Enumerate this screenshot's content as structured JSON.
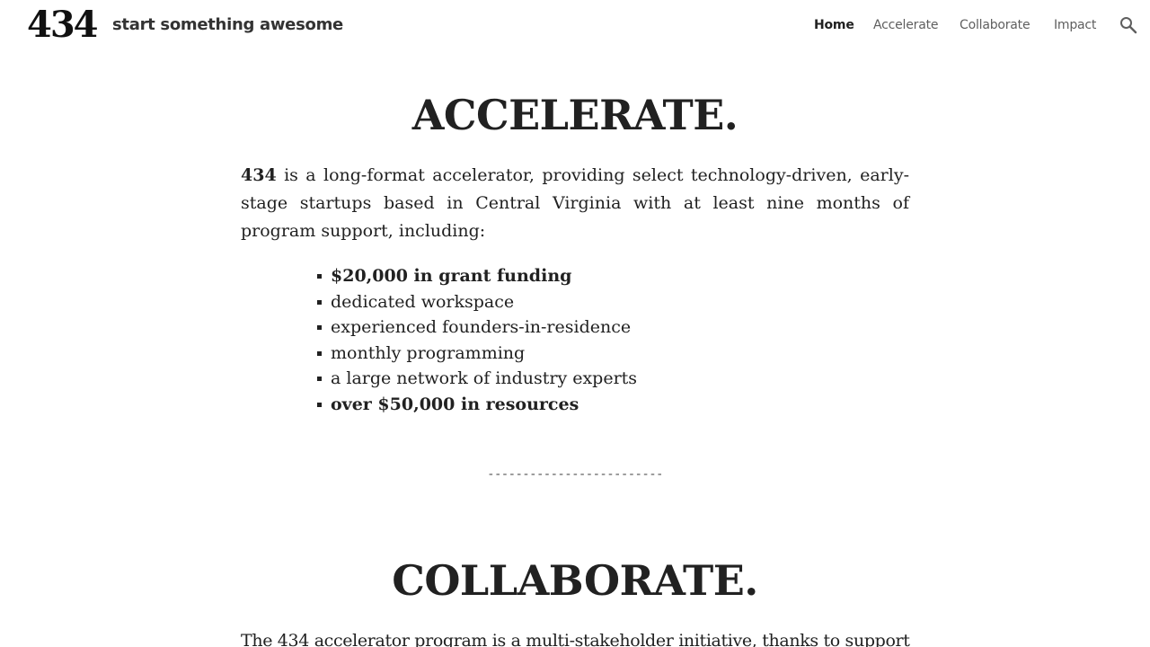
{
  "header": {
    "logo_text": "434",
    "site_title": "start something awesome",
    "nav": [
      {
        "label": "Home",
        "active": true
      },
      {
        "label": "Accelerate",
        "active": false
      },
      {
        "label": "Collaborate",
        "active": false
      },
      {
        "label": "Impact",
        "active": false
      }
    ],
    "search_icon": "search-icon"
  },
  "accelerate": {
    "heading": "ACCELERATE.",
    "intro_bold": "434",
    "intro_rest": " is a long-format accelerator, providing select technology-driven, early-stage startups based in Central Virginia with at least nine months of program support, including:",
    "items": [
      {
        "text": "$20,000 in grant funding",
        "bold": true
      },
      {
        "text": "dedicated workspace",
        "bold": false
      },
      {
        "text": "experienced founders-in-residence",
        "bold": false
      },
      {
        "text": "monthly programming",
        "bold": false
      },
      {
        "text": "a large network of industry experts",
        "bold": false
      },
      {
        "text": "over $50,000 in resources",
        "bold": true
      }
    ]
  },
  "divider": "-------------------------",
  "collaborate": {
    "heading": "COLLABORATE.",
    "intro": "The 434 accelerator program is a multi-stakeholder initiative, thanks to support"
  }
}
